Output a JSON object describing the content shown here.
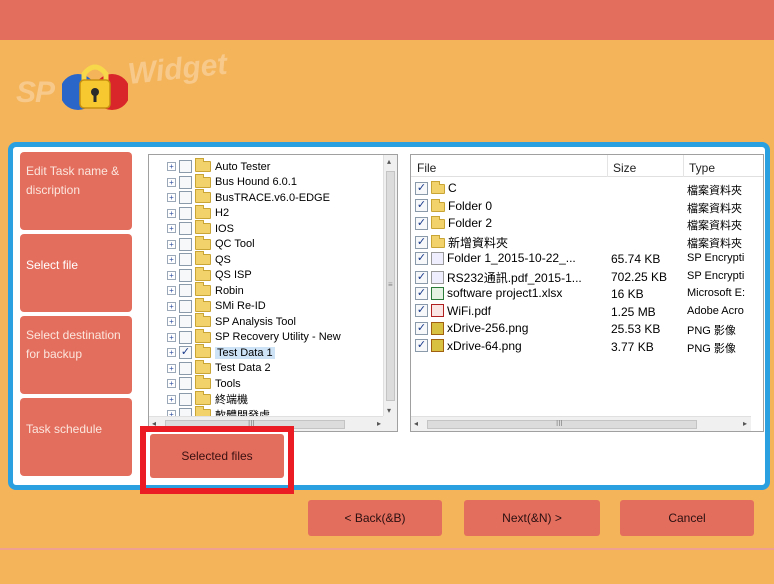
{
  "logo": {
    "brand": "SP",
    "product": "Widget"
  },
  "steps": [
    {
      "label": "Edit Task name & discription"
    },
    {
      "label": "Select file"
    },
    {
      "label": "Select destination for backup"
    },
    {
      "label": "Task schedule"
    }
  ],
  "tree": {
    "items": [
      {
        "label": "Auto Tester",
        "checked": false
      },
      {
        "label": "Bus Hound 6.0.1",
        "checked": false
      },
      {
        "label": "BusTRACE.v6.0-EDGE",
        "checked": false
      },
      {
        "label": "H2",
        "checked": false
      },
      {
        "label": "IOS",
        "checked": false
      },
      {
        "label": "QC Tool",
        "checked": false
      },
      {
        "label": "QS",
        "checked": false
      },
      {
        "label": "QS ISP",
        "checked": false
      },
      {
        "label": "Robin",
        "checked": false
      },
      {
        "label": "SMi Re-ID",
        "checked": false
      },
      {
        "label": "SP Analysis Tool",
        "checked": false
      },
      {
        "label": "SP Recovery Utility - New",
        "checked": false
      },
      {
        "label": "Test Data 1",
        "checked": true,
        "selected": true
      },
      {
        "label": "Test Data 2",
        "checked": false
      },
      {
        "label": "Tools",
        "checked": false
      },
      {
        "label": "終端機",
        "checked": false
      },
      {
        "label": "軟體開發處",
        "checked": false
      }
    ]
  },
  "filelist": {
    "columns": {
      "name": "File",
      "size": "Size",
      "type": "Type"
    },
    "rows": [
      {
        "name": "C",
        "size": "",
        "type": "檔案資料夾",
        "icon": "folder-icon"
      },
      {
        "name": "Folder 0",
        "size": "",
        "type": "檔案資料夾",
        "icon": "folder-icon"
      },
      {
        "name": "Folder 2",
        "size": "",
        "type": "檔案資料夾",
        "icon": "folder-icon"
      },
      {
        "name": "新增資料夾",
        "size": "",
        "type": "檔案資料夾",
        "icon": "folder-icon"
      },
      {
        "name": "Folder 1_2015-10-22_...",
        "size": "65.74 KB",
        "type": "SP Encrypti",
        "icon": "encrypted-file-icon"
      },
      {
        "name": "RS232通訊.pdf_2015-1...",
        "size": "702.25 KB",
        "type": "SP Encrypti",
        "icon": "encrypted-file-icon"
      },
      {
        "name": "software project1.xlsx",
        "size": "16 KB",
        "type": "Microsoft E:",
        "icon": "excel-file-icon"
      },
      {
        "name": "WiFi.pdf",
        "size": "1.25 MB",
        "type": "Adobe Acro",
        "icon": "pdf-file-icon"
      },
      {
        "name": "xDrive-256.png",
        "size": "25.53 KB",
        "type": "PNG 影像",
        "icon": "image-file-icon"
      },
      {
        "name": "xDrive-64.png",
        "size": "3.77 KB",
        "type": "PNG 影像",
        "icon": "image-file-icon"
      }
    ]
  },
  "scrollbar": {
    "left_arrow": "◂",
    "right_arrow": "▸",
    "up_arrow": "▴",
    "down_arrow": "▾",
    "grip": "III",
    "grip_v": "≡"
  },
  "tree_glyphs": {
    "expand": "+",
    "check": "✓"
  },
  "buttons": {
    "selected_files": "Selected files",
    "back": "< Back(&B)",
    "next": "Next(&N) >",
    "cancel": "Cancel"
  }
}
